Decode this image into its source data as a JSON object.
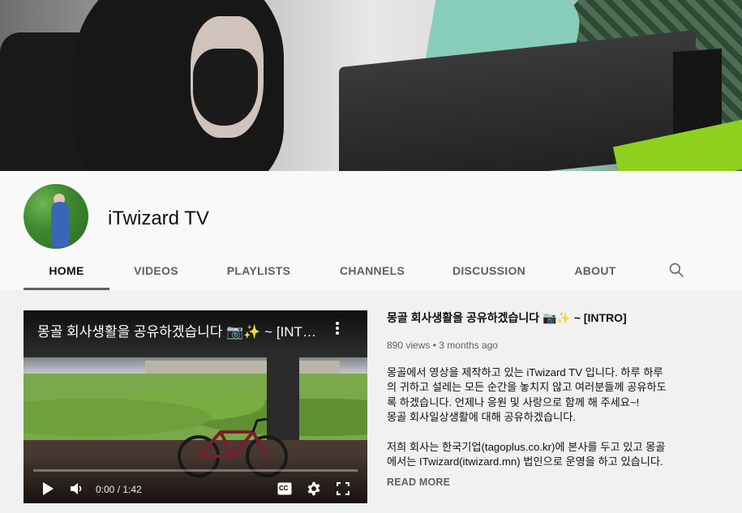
{
  "channel": {
    "name": "iTwizard TV"
  },
  "tabs": [
    {
      "label": "HOME",
      "active": true
    },
    {
      "label": "VIDEOS"
    },
    {
      "label": "PLAYLISTS"
    },
    {
      "label": "CHANNELS"
    },
    {
      "label": "DISCUSSION"
    },
    {
      "label": "ABOUT"
    }
  ],
  "search": {
    "icon": "search-icon"
  },
  "featured_video": {
    "overlay_title": "몽골 회사생활을 공유하겠습니다 📷✨ ~ [INTRO]",
    "title": "몽골 회사생활을 공유하겠습니다 📷✨ ~ [INTRO]",
    "time": "0:00 / 1:42",
    "progress": 0.0,
    "views": "890 views",
    "separator": "•",
    "age": "3 months ago",
    "description": [
      "몽골에서 영상을 제작하고 있는 iTwizard TV 입니다. 하루 하루",
      "의 귀하고 설레는 모든 순간을 놓치지 않고 여러분들께 공유하도",
      "록 하겠습니다. 언제나 응원 및 사랑으로 함께 해 주세요~!",
      "몽골 회사일상생활에 대해 공유하겠습니다.",
      "",
      "저희 회사는 한국기업(tagoplus.co.kr)에 본사를 두고 있고 몽골",
      "에서는 ITwizard(itwizard.mn) 법인으로 운영을 하고 있습니다."
    ],
    "read_more": "READ MORE",
    "captions_label": "CC"
  },
  "colors": {
    "text_primary": "#0f0f0f",
    "text_secondary": "#606060",
    "page_bg": "#f9f9f9",
    "content_bg": "#f1f1f1"
  }
}
